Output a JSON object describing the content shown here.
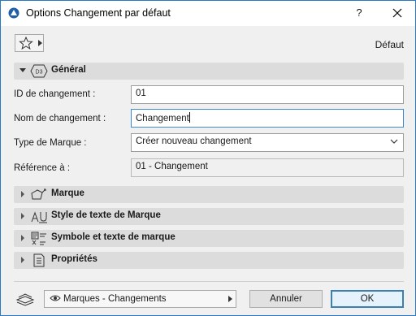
{
  "window": {
    "title": "Options Changement par défaut",
    "help_label": "?"
  },
  "favorites": {
    "default_label": "Défaut"
  },
  "general": {
    "label": "Général",
    "icon_text": "D3",
    "fields": {
      "change_id": {
        "label": "ID de changement :",
        "value": "01"
      },
      "change_name": {
        "label": "Nom de changement :",
        "value": "Changement"
      },
      "marker_type": {
        "label": "Type de Marque :",
        "value": "Créer nouveau changement"
      },
      "reference": {
        "label": "Référence à :",
        "value": "01 - Changement"
      }
    }
  },
  "panels": {
    "marker": "Marque",
    "marker_text_style": "Style de texte de Marque",
    "symbol_text": "Symbole et texte de marque",
    "properties": "Propriétés"
  },
  "footer": {
    "layer": "Marques - Changements",
    "cancel": "Annuler",
    "ok": "OK"
  },
  "colors": {
    "accent": "#2b79c2",
    "panel_bg": "#dcdcdc",
    "focus_border": "#3f87cf"
  }
}
